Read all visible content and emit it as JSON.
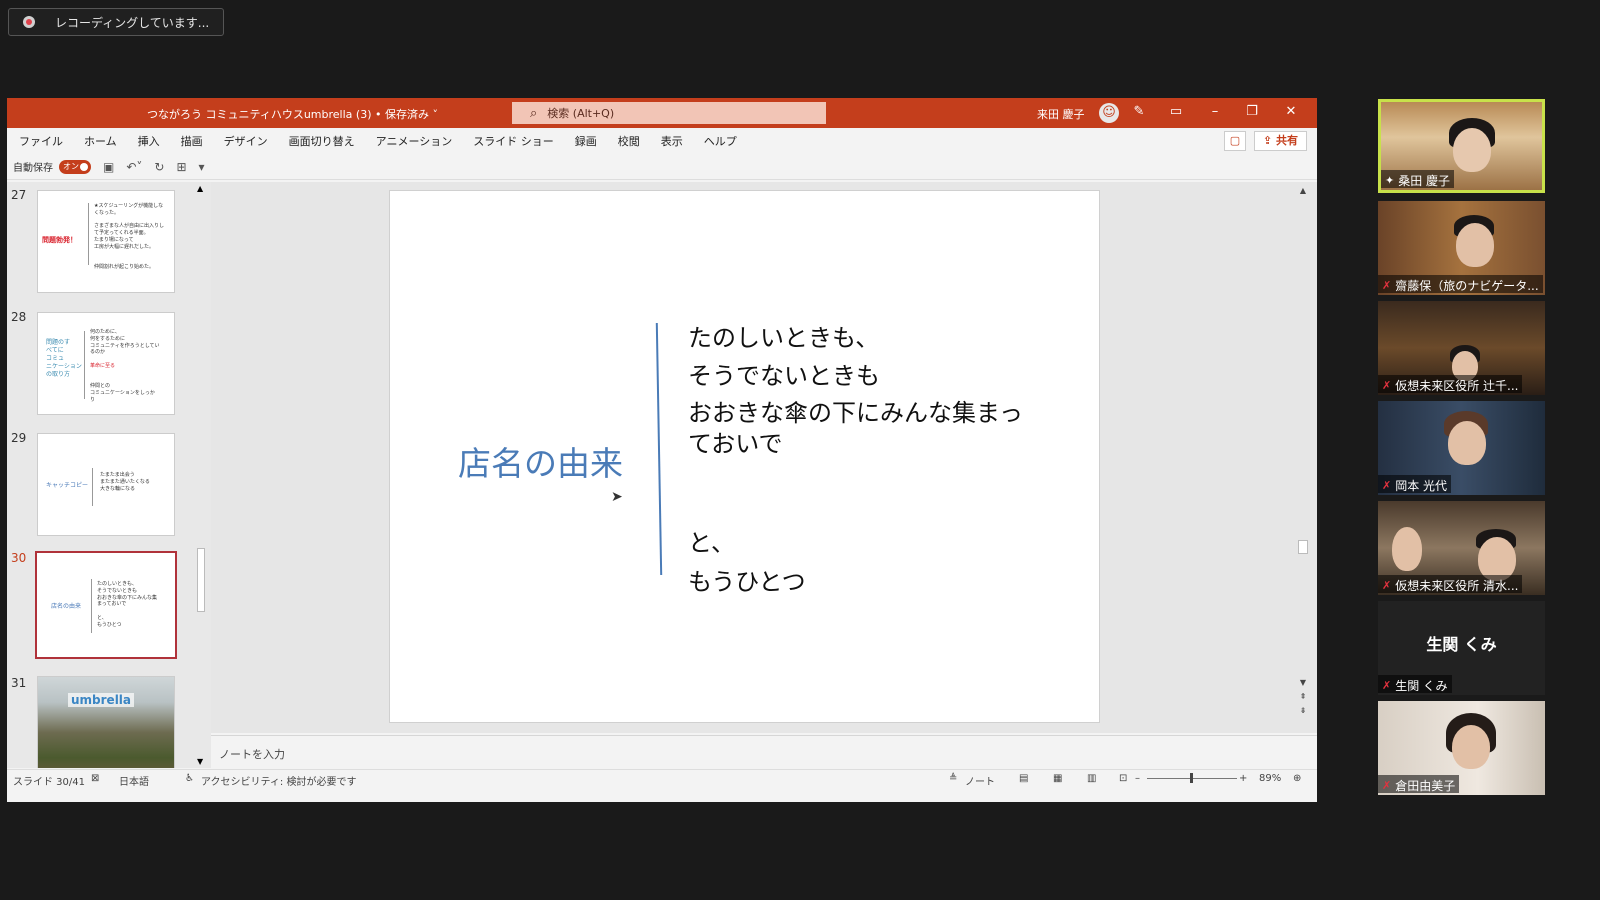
{
  "recording": {
    "text": "レコーディングしています..."
  },
  "window": {
    "title": "つながろう コミュニティハウスumbrella (3) • 保存済み ˅",
    "search_placeholder": "検索 (Alt+Q)",
    "user_name": "来田 慶子",
    "accent_color": "#c43e1c"
  },
  "menu": [
    "ファイル",
    "ホーム",
    "挿入",
    "描画",
    "デザイン",
    "画面切り替え",
    "アニメーション",
    "スライド ショー",
    "録画",
    "校閲",
    "表示",
    "ヘルプ"
  ],
  "share_label": "共有",
  "qat": {
    "autosave_label": "自動保存",
    "autosave_state": "オン"
  },
  "thumbnails": [
    {
      "num": "27",
      "title": "問題勃発！",
      "body": "★スケジューリングが機能しな\nくなった。\n\nさまざまな人が自由に出入りし\nて予定ってくれる半面。\nたまり場になって\n工房が大幅に遅れだした。\n\n\n仲間割れが起こり始めた。"
    },
    {
      "num": "28",
      "title": "問題のす\nべてに\nコミュ\nニケーション\nの取り方",
      "body": "何のために、\n何をするために\nコミュニティを作ろうとしてい\nるのか\n\n\n\n\n仲間との\nコミュニケーションをしっか\nり",
      "red": "革命に至る"
    },
    {
      "num": "29",
      "title": "キャッチコピー",
      "body": "たまたま出会う\nまたまた通いたくなる\n大きな輪になる"
    },
    {
      "num": "30",
      "title": "店名の由来",
      "body": "たのしいときも、\nそうでないときも\nおおきな傘の下にみんな集\nまっておいで\n\nと、\nもうひとつ"
    },
    {
      "num": "31",
      "logo": "umbrella"
    }
  ],
  "slide": {
    "title": "店名の由来",
    "lines": [
      "たのしいときも、",
      "そうでないときも",
      "おおきな傘の下にみんな集まっておいで",
      "と、",
      "もうひとつ"
    ]
  },
  "notes_placeholder": "ノートを入力",
  "status": {
    "slide_count": "スライド 30/41",
    "language": "日本語",
    "accessibility": "アクセシビリティ: 検討が必要です",
    "notes_btn": "ノート",
    "zoom": "89%"
  },
  "participants": [
    {
      "name": "桑田 慶子",
      "pinned": true,
      "active": true
    },
    {
      "name": "齋藤保（旅のナビゲータ...",
      "muted": true
    },
    {
      "name": "仮想未来区役所 辻千...",
      "muted": true
    },
    {
      "name": "岡本 光代",
      "muted": true
    },
    {
      "name": "仮想未来区役所 清水...",
      "muted": true
    },
    {
      "name": "生関 くみ",
      "muted": true,
      "no_video": true,
      "display_name": "生関 くみ"
    },
    {
      "name": "倉田由美子",
      "muted": true
    }
  ]
}
